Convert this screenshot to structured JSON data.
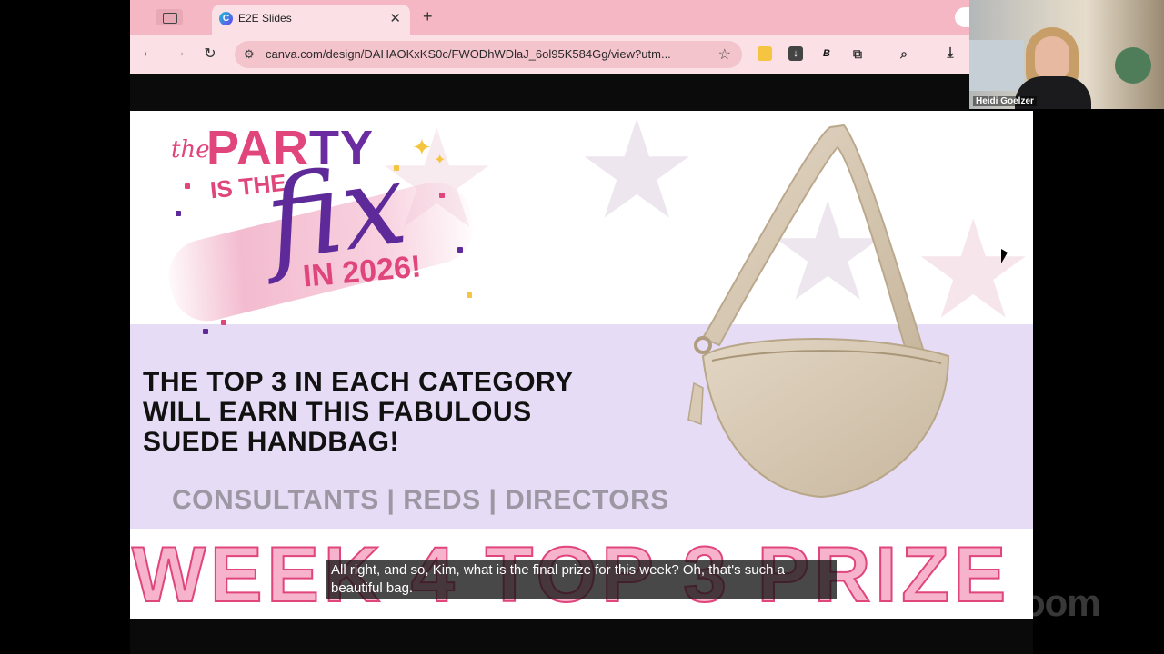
{
  "browser": {
    "tab_title": "E2E Slides",
    "favicon_letter": "C",
    "url": "canva.com/design/DAHAOKxKS0c/FWODhWDlaJ_6ol95K584Gg/view?utm...",
    "theme_color": "#f7c6cf",
    "extensions": [
      "yellow-square-icon",
      "download-ext-icon",
      "B",
      "puzzle-icon",
      "tab-search-icon"
    ]
  },
  "slide": {
    "logo": {
      "the": "the",
      "party_p1": "PAR",
      "party_p2": "TY",
      "is_the": "IS THE",
      "fix": "fix",
      "year": "IN 2026!"
    },
    "headline_lines": [
      "THE TOP 3 IN EACH CATEGORY",
      "WILL EARN THIS FABULOUS",
      "SUEDE HANDBAG!"
    ],
    "categories": "CONSULTANTS | REDS | DIRECTORS",
    "banner": "WEEK 4 TOP 3 PRIZE",
    "accent_pink": "#e0457b",
    "accent_purple": "#5e2a9a"
  },
  "caption": {
    "text": "All right, and so, Kim, what is the final prize for this week? Oh, that's such a beautiful bag."
  },
  "webcam": {
    "participant_name": "Heidi Goelzer"
  },
  "watermark": "zoom"
}
